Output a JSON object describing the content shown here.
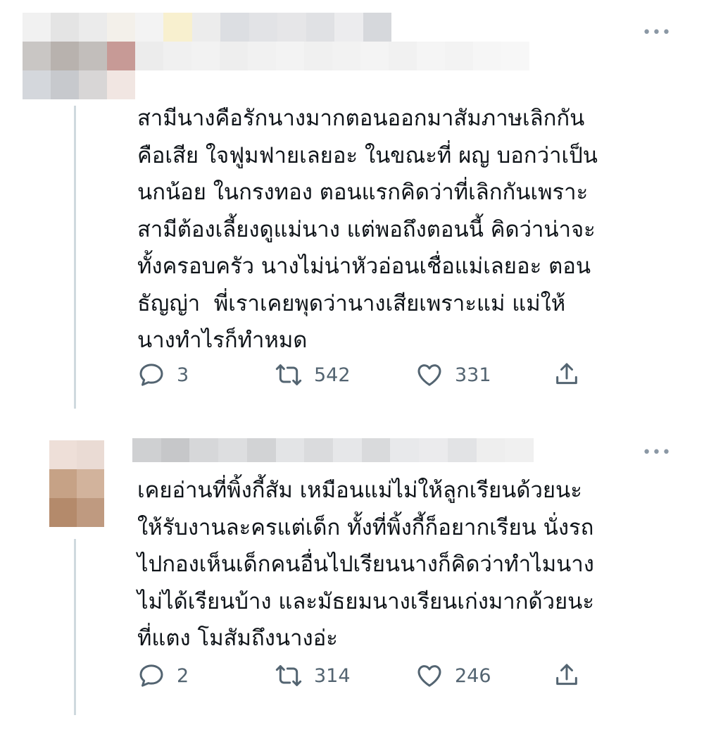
{
  "tweets": [
    {
      "text": "สามีนางคือรักนางมากตอนออกมาสัมภาษเลิกกัน\nคือเสีย ใจฟูมฟายเลยอะ ในขณะที่ ผญ บอกว่าเป็น\nนกน้อย ในกรงทอง ตอนแรกคิดว่าที่เลิกกันเพราะ\nสามีต้องเลี้ยงดูแม่นาง แต่พอถึงตอนนี้ คิดว่าน่าจะ\nทั้งครอบครัว นางไม่น่าหัวอ่อนเชื่อแม่เลยอะ ตอน\nธัญญ่า  พี่เราเคยพุดว่านางเสียเพราะแม่ แม่ให้\nนางทำไรก็ทำหมด",
      "replies": "3",
      "retweets": "542",
      "likes": "331",
      "more_label": "•••"
    },
    {
      "text": "เคยอ่านที่พิ้งกี้สัม เหมือนแม่ไม่ให้ลูกเรียนด้วยนะ\nให้รับงานละครแต่เด็ก ทั้งที่พิ้งกี้ก็อยากเรียน นั่งรถ\nไปกองเห็นเด็กคนอื่นไปเรียนนางก็คิดว่าทำไมนาง\nไม่ได้เรียนบ้าง และมัธยมนางเรียนเก่งมากด้วยนะ\nที่แตง โมสัมถึงนางอ่ะ",
      "replies": "2",
      "retweets": "314",
      "likes": "246",
      "more_label": "•••"
    }
  ],
  "colors": {
    "text": "#0f1419",
    "meta": "#536471",
    "icon": "#536471",
    "thread_line": "#cfd9de"
  },
  "icons": [
    "reply-icon",
    "retweet-icon",
    "like-icon",
    "share-icon",
    "more-icon"
  ]
}
